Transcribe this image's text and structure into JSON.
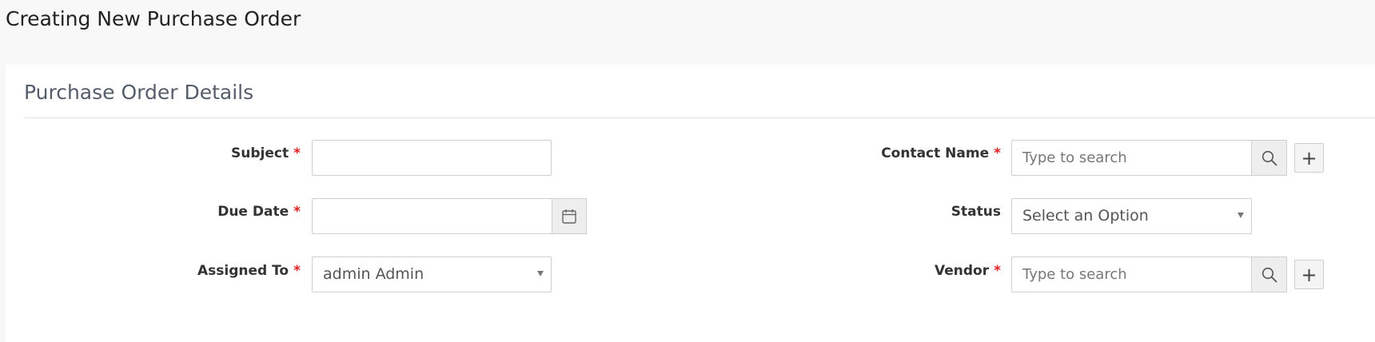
{
  "page": {
    "title": "Creating New Purchase Order"
  },
  "panel": {
    "title": "Purchase Order Details"
  },
  "fields": {
    "subject": {
      "label": "Subject",
      "required_mark": "*",
      "value": ""
    },
    "due_date": {
      "label": "Due Date",
      "required_mark": "*",
      "value": ""
    },
    "assigned_to": {
      "label": "Assigned To",
      "required_mark": "*",
      "selected": "admin Admin"
    },
    "contact_name": {
      "label": "Contact Name",
      "required_mark": "*",
      "placeholder": "Type to search",
      "add_label": "+"
    },
    "status": {
      "label": "Status",
      "selected": "Select an Option"
    },
    "vendor": {
      "label": "Vendor",
      "required_mark": "*",
      "placeholder": "Type to search",
      "add_label": "+"
    }
  },
  "icons": {
    "calendar": "calendar-icon",
    "search": "search-icon",
    "caret": "caret-down-icon"
  },
  "colors": {
    "required": "#e02020",
    "panel_title": "#555d6b",
    "addon_bg": "#eeeeee"
  }
}
